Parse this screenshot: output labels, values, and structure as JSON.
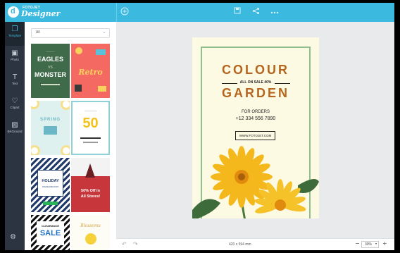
{
  "app": {
    "logo_letter": "d",
    "logo_small": "FOTOJET",
    "logo_big": "Designer"
  },
  "toolbar": {
    "add_icon": "plus-circle-icon",
    "save_icon": "save-icon",
    "share_icon": "share-icon",
    "more_icon": "more-icon"
  },
  "nav": {
    "items": [
      {
        "label": "Template",
        "icon": "template-icon"
      },
      {
        "label": "Photo",
        "icon": "photo-icon"
      },
      {
        "label": "Text",
        "icon": "text-icon"
      },
      {
        "label": "Clipart",
        "icon": "clipart-icon"
      },
      {
        "label": "BKGround",
        "icon": "background-icon"
      }
    ],
    "settings_icon": "settings-icon"
  },
  "panel": {
    "filter_value": "All",
    "templates": [
      {
        "name": "eagles-monster",
        "line1": "EAGLES",
        "line2": "MONSTER"
      },
      {
        "name": "retro",
        "line1": "Retro"
      },
      {
        "name": "spring",
        "line1": "SPRING"
      },
      {
        "name": "fifty-percent",
        "line1": "50"
      },
      {
        "name": "holiday",
        "line1": "HOLIDAY",
        "line2": "ONLINE DISCOUNT"
      },
      {
        "name": "fifty-off",
        "line1": "50% Off in",
        "line2": "All Stores!"
      },
      {
        "name": "clearance-sale",
        "line1": "CLEARANCE",
        "line2": "SALE"
      },
      {
        "name": "blossoms",
        "line1": "Blossoms"
      }
    ]
  },
  "poster": {
    "title1": "COLOUR",
    "sale": "ALL ON SALE 40%",
    "title2": "GARDEN",
    "orders": "FOR ORDERS",
    "phone": "+12 334 556 7890",
    "website": "WWW.FOTOJET.COM",
    "colors": {
      "background": "#fdfae4",
      "frame": "#8fbf8f",
      "title": "#b5651d",
      "petal": "#f4b81c"
    }
  },
  "bottom": {
    "size": "420 x 594 mm",
    "zoom": "30%",
    "undo_icon": "undo-icon",
    "redo_icon": "redo-icon"
  }
}
